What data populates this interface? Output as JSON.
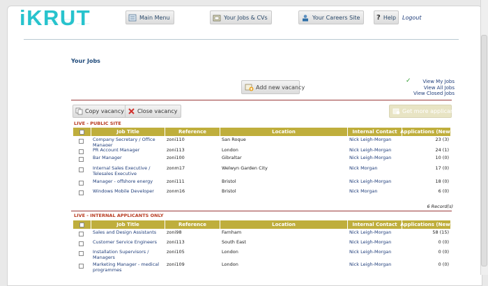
{
  "logo": "iKRUT",
  "nav": {
    "main_menu": "Main Menu",
    "jobs_cvs": "Your Jobs & CVs",
    "careers_site": "Your Careers Site",
    "help": "Help",
    "logout": "Logout"
  },
  "page_title": "Your Jobs",
  "add_vacancy": "Add new vacancy",
  "view_links": [
    "View My Jobs",
    "View All Jobs",
    "View Closed Jobs"
  ],
  "toolbar": {
    "copy": "Copy vacancy",
    "close": "Close vacancy",
    "get_more": "Get more applicants"
  },
  "columns": [
    "Job Title",
    "Reference",
    "Location",
    "Internal Contact",
    "Applications (New)"
  ],
  "sections": [
    {
      "label": "LIVE - PUBLIC SITE",
      "records": "6 Record(s)",
      "rows": [
        {
          "title": "Company Secretary / Office Manager",
          "ref": "zoni110",
          "location": "San Roque",
          "contact": "Nick Leigh-Morgan",
          "apps": "23 (3)"
        },
        {
          "title": "PR Account Manager",
          "ref": "zoni113",
          "location": "London",
          "contact": "Nick Leigh-Morgan",
          "apps": "24 (1)"
        },
        {
          "title": "Bar Manager",
          "ref": "zoni100",
          "location": "Gibraltar",
          "contact": "Nick Leigh-Morgan",
          "apps": "10 (0)"
        },
        {
          "title": "Internal Sales Executive / Telesales Executive",
          "ref": "zonm17",
          "location": "Welwyn Garden City",
          "contact": "Nick Morgan",
          "apps": "17 (0)"
        },
        {
          "title": "Manager - offshore energy",
          "ref": "zoni111",
          "location": "Bristol",
          "contact": "Nick Leigh-Morgan",
          "apps": "18 (0)"
        },
        {
          "title": "Windows Mobile Developer",
          "ref": "zonm16",
          "location": "Bristol",
          "contact": "Nick Morgan",
          "apps": "6 (0)"
        }
      ]
    },
    {
      "label": "LIVE - INTERNAL APPLICANTS ONLY",
      "rows": [
        {
          "title": "Sales and Design Assistants",
          "ref": "zoni98",
          "location": "Farnham",
          "contact": "Nick Leigh-Morgan",
          "apps": "58 (15)"
        },
        {
          "title": "Customer Service Engineers",
          "ref": "zoni113",
          "location": "South East",
          "contact": "Nick Leigh-Morgan",
          "apps": "0 (0)"
        },
        {
          "title": "Installation Supervisors / Managers",
          "ref": "zoni105",
          "location": "London",
          "contact": "Nick Leigh-Morgan",
          "apps": "0 (0)"
        },
        {
          "title": "Marketing Manager - medical programmes",
          "ref": "zoni109",
          "location": "London",
          "contact": "Nick Leigh-Morgan",
          "apps": "0 (0)"
        }
      ]
    }
  ]
}
